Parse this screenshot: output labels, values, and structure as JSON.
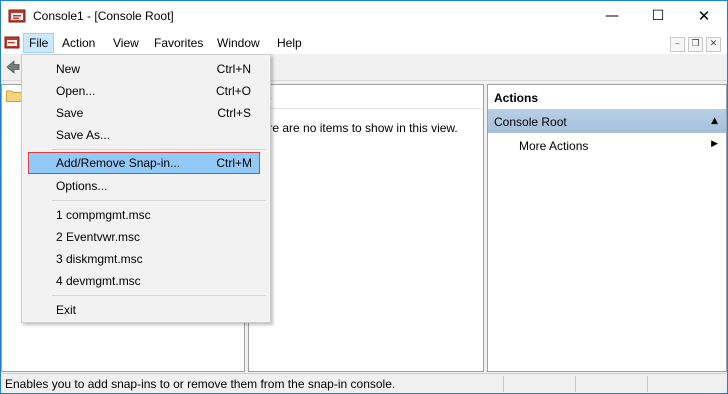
{
  "window": {
    "title": "Console1 - [Console Root]"
  },
  "window_controls": {
    "minimize": "—",
    "maximize": "☐",
    "close": "✕"
  },
  "menubar": {
    "items": [
      {
        "label": "File"
      },
      {
        "label": "Action"
      },
      {
        "label": "View"
      },
      {
        "label": "Favorites"
      },
      {
        "label": "Window"
      },
      {
        "label": "Help"
      }
    ],
    "mdi_buttons": [
      "–",
      "❐",
      "✕"
    ]
  },
  "file_menu": {
    "items": [
      {
        "label": "New",
        "shortcut": "Ctrl+N"
      },
      {
        "label": "Open...",
        "shortcut": "Ctrl+O"
      },
      {
        "label": "Save",
        "shortcut": "Ctrl+S"
      },
      {
        "label": "Save As...",
        "shortcut": ""
      },
      {
        "label": "Add/Remove Snap-in...",
        "shortcut": "Ctrl+M"
      },
      {
        "label": "Options...",
        "shortcut": ""
      },
      {
        "label": "1 compmgmt.msc",
        "shortcut": ""
      },
      {
        "label": "2 Eventvwr.msc",
        "shortcut": ""
      },
      {
        "label": "3 diskmgmt.msc",
        "shortcut": ""
      },
      {
        "label": "4 devmgmt.msc",
        "shortcut": ""
      },
      {
        "label": "Exit",
        "shortcut": ""
      }
    ]
  },
  "center_pane": {
    "column_header": "me",
    "empty_message": "here are no items to show in this view."
  },
  "actions_pane": {
    "header": "Actions",
    "section": "Console Root",
    "section_arrow": "▲",
    "more_actions": "More Actions",
    "more_actions_arrow": "▶"
  },
  "statusbar": {
    "text": "Enables you to add snap-ins to or remove them from the snap-in console."
  },
  "colors": {
    "menu_highlight": "#91c9f7",
    "highlight_border": "#e03c3c",
    "actions_section": "#b9cfe6",
    "window_border": "#1883d7"
  }
}
